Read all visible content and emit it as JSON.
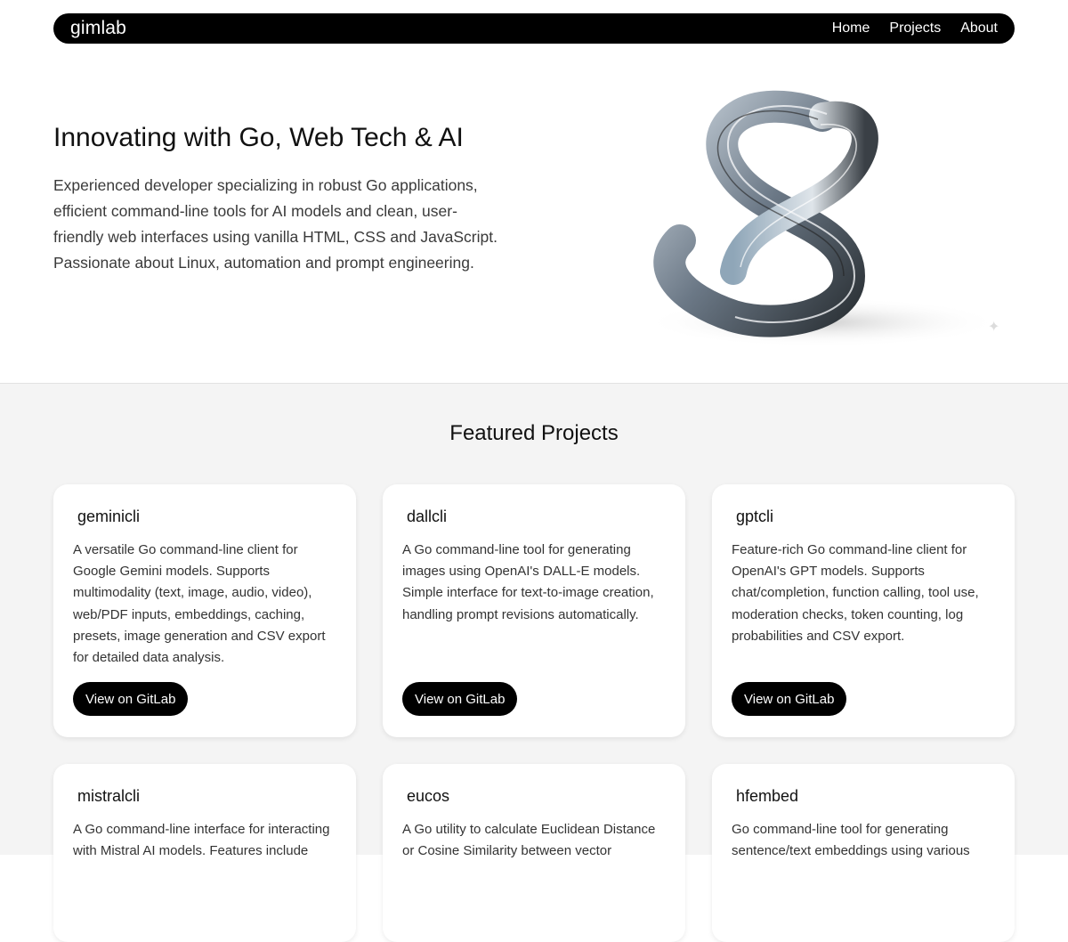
{
  "nav": {
    "brand": "gimlab",
    "links": [
      "Home",
      "Projects",
      "About"
    ]
  },
  "hero": {
    "title": "Innovating with Go, Web Tech & AI",
    "description": "Experienced developer specializing in robust Go applications, efficient command-line tools for AI models and clean, user-friendly web interfaces using vanilla HTML, CSS and JavaScript. Passionate about Linux, automation and prompt engineering."
  },
  "projects": {
    "heading": "Featured Projects",
    "button_label": "View on GitLab",
    "items": [
      {
        "name": "geminicli",
        "description": "A versatile Go command-line client for Google Gemini models. Supports multimodality (text, image, audio, video), web/PDF inputs, embeddings, caching, presets, image generation and CSV export for detailed data analysis."
      },
      {
        "name": "dallcli",
        "description": "A Go command-line tool for generating images using OpenAI's DALL-E models. Simple interface for text-to-image creation, handling prompt revisions automatically."
      },
      {
        "name": "gptcli",
        "description": "Feature-rich Go command-line client for OpenAI's GPT models. Supports chat/completion, function calling, tool use, moderation checks, token counting, log probabilities and CSV export."
      },
      {
        "name": "mistralcli",
        "description": "A Go command-line interface for interacting with Mistral AI models. Features include"
      },
      {
        "name": "eucos",
        "description": "A Go utility to calculate Euclidean Distance or Cosine Similarity between vector"
      },
      {
        "name": "hfembed",
        "description": "Go command-line tool for generating sentence/text embeddings using various"
      }
    ]
  }
}
